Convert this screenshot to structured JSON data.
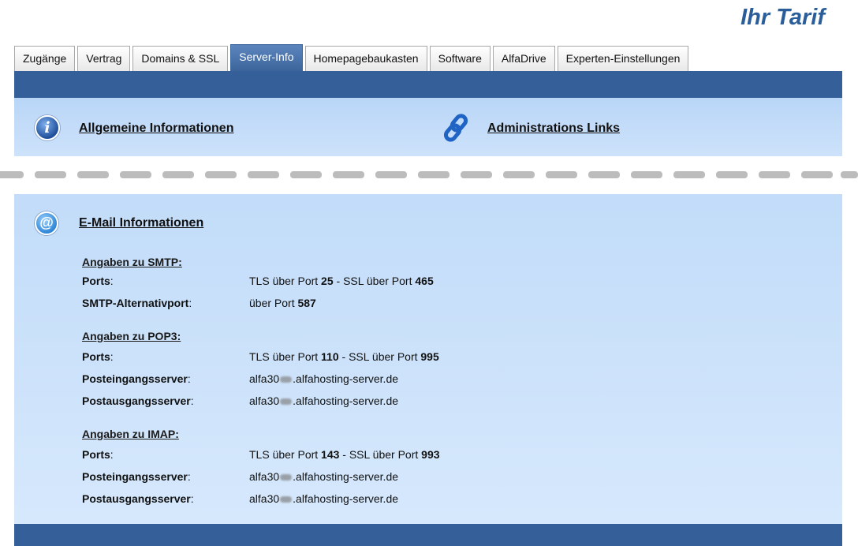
{
  "header": {
    "title": "Ihr Tarif"
  },
  "tabs": [
    {
      "label": "Zugänge"
    },
    {
      "label": "Vertrag"
    },
    {
      "label": "Domains & SSL"
    },
    {
      "label": "Server-Info",
      "active": true
    },
    {
      "label": "Homepagebaukasten"
    },
    {
      "label": "Software"
    },
    {
      "label": "AlfaDrive"
    },
    {
      "label": "Experten-Einstellungen"
    }
  ],
  "sections": {
    "general": {
      "label": "Allgemeine Informationen",
      "icon": "info-icon"
    },
    "admin": {
      "label": "Administrations Links",
      "icon": "link-icon"
    },
    "email": {
      "label": "E-Mail Informationen",
      "icon": "at-icon"
    }
  },
  "smtp": {
    "heading": "Angaben zu SMTP:",
    "ports_label": "Ports",
    "ports": {
      "prefix": "TLS über Port ",
      "tls": "25",
      "mid": " - SSL über Port ",
      "ssl": "465"
    },
    "alt_label": "SMTP-Alternativport",
    "alt": {
      "prefix": "über Port ",
      "port": "587"
    }
  },
  "pop3": {
    "heading": "Angaben zu POP3:",
    "ports_label": "Ports",
    "ports": {
      "prefix": "TLS über Port ",
      "tls": "110",
      "mid": " - SSL über Port ",
      "ssl": "995"
    },
    "in_label": "Posteingangsserver",
    "in": {
      "host_prefix": "alfa30",
      "host_suffix": ".alfahosting-server.de"
    },
    "out_label": "Postausgangsserver",
    "out": {
      "host_prefix": "alfa30",
      "host_suffix": ".alfahosting-server.de"
    }
  },
  "imap": {
    "heading": "Angaben zu IMAP:",
    "ports_label": "Ports",
    "ports": {
      "prefix": "TLS über Port ",
      "tls": "143",
      "mid": " - SSL über Port ",
      "ssl": "993"
    },
    "in_label": "Posteingangsserver",
    "in": {
      "host_prefix": "alfa30",
      "host_suffix": ".alfahosting-server.de"
    },
    "out_label": "Postausgangsserver",
    "out": {
      "host_prefix": "alfa30",
      "host_suffix": ".alfahosting-server.de"
    }
  },
  "colors": {
    "brand_blue": "#355f99",
    "title_blue": "#2a5e9a",
    "panel_blue": "#c2dcf9"
  }
}
